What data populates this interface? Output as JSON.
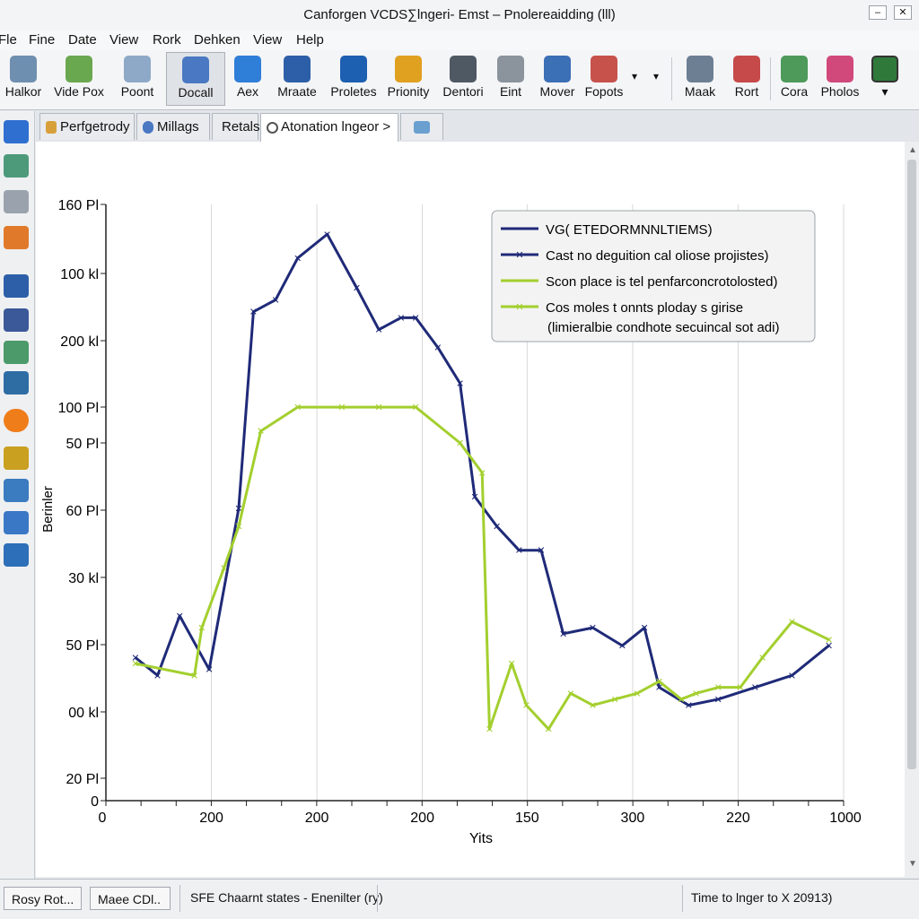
{
  "window": {
    "title": "Canforgen VCDS∑lngeri- Emst – Pnolereaidding (lll)",
    "minimize_label": "–",
    "close_label": "✕"
  },
  "menu": [
    "Fle",
    "Fine",
    "Date",
    "View",
    "Rork",
    "Dehken",
    "View",
    "Help"
  ],
  "toolbar": {
    "buttons": [
      {
        "label": "Halkor",
        "icon": "globe-tool-icon",
        "color": "#6f8fb0"
      },
      {
        "label": "Vide Pox",
        "icon": "video-box-icon",
        "color": "#6aa84f"
      },
      {
        "label": "Poont",
        "icon": "search-globe-icon",
        "color": "#8ea9c8"
      },
      {
        "label": "Docall",
        "icon": "checkbox-document-icon",
        "color": "#4a78c2"
      },
      {
        "label": "Aex",
        "icon": "earth-globe-icon",
        "color": "#2f7ed8"
      },
      {
        "label": "Mraate",
        "icon": "target-icon",
        "color": "#2d5fa8"
      },
      {
        "label": "Proletes",
        "icon": "blue-document-icon",
        "color": "#1d5fb0"
      },
      {
        "label": "Prionity",
        "icon": "tools-icon",
        "color": "#e0a020"
      },
      {
        "label": "Dentori",
        "icon": "printer-icon",
        "color": "#4f5964"
      },
      {
        "label": "Eint",
        "icon": "gear-icon",
        "color": "#8b939c"
      },
      {
        "label": "Mover",
        "icon": "monitor-icon",
        "color": "#3b6fb6"
      },
      {
        "label": "Fopots",
        "icon": "photo-badge-icon",
        "color": "#c7524b"
      },
      {
        "label": "Maak",
        "icon": "magnifier-icon",
        "color": "#6d7f93"
      },
      {
        "label": "Rort",
        "icon": "report-icon",
        "color": "#c64a4a"
      },
      {
        "label": "Cora",
        "icon": "chart-icon",
        "color": "#4d9a5a"
      },
      {
        "label": "Pholos",
        "icon": "photos-icon",
        "color": "#d1497a"
      }
    ],
    "overflow_more": "▾",
    "overflow_dropdown": "▾",
    "right_dropdown": "▾"
  },
  "sidebar": [
    {
      "icon": "blue-tool-icon",
      "color": "#2f6fd0"
    },
    {
      "icon": "green-gear-icon",
      "color": "#4d9a7a"
    },
    {
      "icon": "document-icon",
      "color": "#9aa3ad"
    },
    {
      "icon": "orange-disc-icon",
      "color": "#e07a2a"
    },
    {
      "icon": "blue-person-icon",
      "color": "#2d5fa8"
    },
    {
      "icon": "facebook-icon",
      "color": "#3b5998"
    },
    {
      "icon": "colorful-app-icon",
      "color": "#4c9a6a"
    },
    {
      "icon": "photo-icon",
      "color": "#2e6da4"
    },
    {
      "icon": "warning-icon",
      "color": "#ef7d1a"
    },
    {
      "icon": "pencil-icon",
      "color": "#c9a020"
    },
    {
      "icon": "device-icon",
      "color": "#3b7bc0"
    },
    {
      "icon": "chart-bars-icon",
      "color": "#3a78c6"
    },
    {
      "icon": "network-icon",
      "color": "#2d6fb8"
    }
  ],
  "tabs": [
    {
      "label": "Perfgetrody",
      "icon": "tab-doc-icon",
      "color": "#d8a03a"
    },
    {
      "label": "Millags",
      "icon": "tab-globe-icon",
      "color": "#4a78c2"
    },
    {
      "label": "Retals",
      "icon": "",
      "color": ""
    },
    {
      "label": "Atonation lngeor >",
      "icon": "tab-refresh-icon",
      "color": "#555"
    },
    {
      "label": "",
      "icon": "tab-tool-icon",
      "color": "#6aa0d0"
    }
  ],
  "chart_data": {
    "type": "line",
    "ylabel": "Berinler",
    "xlabel": "Yits",
    "x_tick_labels": [
      "0",
      "200",
      "200",
      "200",
      "150",
      "300",
      "220",
      "1000"
    ],
    "y_tick_labels": [
      "160 Pl",
      "100 kl",
      "200 kl",
      "100 Pl",
      "50 Pl",
      "60 Pl",
      "30 kl",
      "50 Pl",
      "00 kl",
      "20 Pl",
      "0"
    ],
    "grid": "vertical",
    "legend_position": "top-right",
    "legend": [
      {
        "text": "VG( ETEDORMNNLTIEMS)",
        "marker": false
      },
      {
        "text": "Cast no deguition cal oliose projistes)",
        "marker": true
      },
      {
        "text": "Scon place is tel penfarconcrotolosted)",
        "marker": false
      },
      {
        "text": "Cos moles t onnts ploday s girise",
        "marker": true
      },
      {
        "text": "(limieralbie condhote secuincal sot adi)",
        "marker": false
      }
    ],
    "colors": {
      "series1": "#1f2a78",
      "series2": "#a3cf2e"
    },
    "series": [
      {
        "x": [
          0.04,
          0.07,
          0.1,
          0.14,
          0.18,
          0.2,
          0.23,
          0.26,
          0.3,
          0.34,
          0.37,
          0.4,
          0.42,
          0.45,
          0.48,
          0.5,
          0.53,
          0.56,
          0.59,
          0.62,
          0.66,
          0.7,
          0.73,
          0.75,
          0.79,
          0.83,
          0.88,
          0.93,
          0.98
        ],
        "y": [
          52,
          49,
          60,
          54,
          84,
          111,
          138,
          142,
          146,
          141,
          133,
          137,
          137,
          131,
          124,
          89,
          84,
          81,
          80,
          65,
          67,
          61,
          67,
          57,
          54,
          57,
          61,
          60,
          58
        ],
        "yrel": [
          0.24,
          0.21,
          0.31,
          0.22,
          0.49,
          0.82,
          0.84,
          0.91,
          0.95,
          0.86,
          0.79,
          0.81,
          0.81,
          0.76,
          0.7,
          0.51,
          0.46,
          0.42,
          0.42,
          0.28,
          0.29,
          0.26,
          0.29,
          0.19,
          0.16,
          0.17,
          0.19,
          0.21,
          0.26
        ]
      },
      {
        "x": [
          0.04,
          0.12,
          0.13,
          0.16,
          0.18,
          0.21,
          0.26,
          0.32,
          0.37,
          0.42,
          0.48,
          0.51,
          0.52,
          0.55,
          0.57,
          0.6,
          0.63,
          0.66,
          0.69,
          0.72,
          0.75,
          0.78,
          0.8,
          0.83,
          0.86,
          0.89,
          0.93,
          0.98
        ],
        "yrel": [
          0.23,
          0.21,
          0.29,
          0.39,
          0.46,
          0.62,
          0.66,
          0.66,
          0.66,
          0.66,
          0.6,
          0.55,
          0.12,
          0.23,
          0.16,
          0.12,
          0.18,
          0.16,
          0.17,
          0.18,
          0.2,
          0.17,
          0.18,
          0.19,
          0.19,
          0.24,
          0.3,
          0.27
        ]
      }
    ]
  },
  "status": {
    "button1": "Rosy Rot...",
    "button2": "Maee CDl..",
    "text1": "SFE Chaarnt states - Enenilter (ry)",
    "text2": "Time to lnger to X 20913)"
  }
}
